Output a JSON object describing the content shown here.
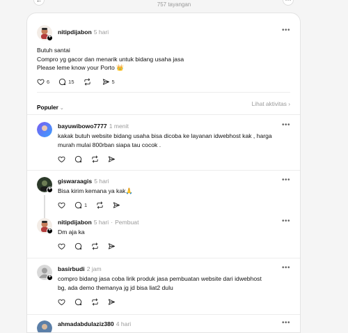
{
  "header": {
    "views": "757 tayangan",
    "back_icon": "arrow-left-icon",
    "menu_icon": "more-icon"
  },
  "post": {
    "username": "nitipdijabon",
    "time": "5 hari",
    "lines": [
      "Butuh santai",
      "Compro yg gacor dan menarik untuk bidang usaha jasa",
      "Please leme know your Porto 👑"
    ],
    "likes": "6",
    "replies": "15",
    "reposts": "",
    "shares": "5"
  },
  "sort": {
    "label": "Populer",
    "activity": "Lihat aktivitas"
  },
  "replies": [
    {
      "username": "bayuwibowo7777",
      "time": "1 menit",
      "author_tag": "",
      "lines": [
        "kakak butuh website bidang usaha bisa dicoba ke layanan idwebhost kak , harga",
        "murah mulai 800rban siapa tau cocok ."
      ],
      "reply_count": ""
    },
    {
      "username": "giswaraagis",
      "time": "5 hari",
      "author_tag": "",
      "lines": [
        "Bisa kirim kemana ya kak🙏"
      ],
      "reply_count": "1"
    },
    {
      "username": "nitipdijabon",
      "time": "5 hari",
      "author_tag": "Pembuat",
      "lines": [
        "Dm aja ka"
      ],
      "reply_count": ""
    },
    {
      "username": "basirbudi",
      "time": "2 jam",
      "author_tag": "",
      "lines": [
        "compro bidang jasa coba lirik produk jasa pembuatan website dari idwebhost",
        "bg, ada demo themanya jg jd bisa liat2 dulu"
      ],
      "reply_count": ""
    },
    {
      "username": "ahmadabdulaziz380",
      "time": "4 hari",
      "author_tag": "",
      "lines": [],
      "reply_count": ""
    }
  ],
  "colors": {
    "accent": "#000000",
    "muted": "#999999",
    "divider": "#ececec"
  }
}
